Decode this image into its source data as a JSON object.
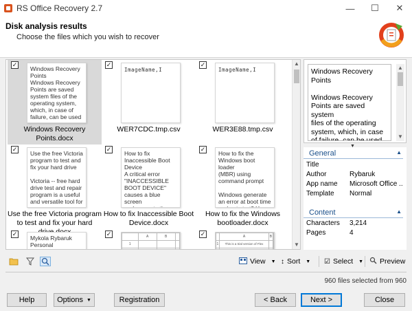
{
  "window": {
    "title": "RS Office Recovery 2.7",
    "minimize_glyph": "—",
    "maximize_glyph": "☐",
    "close_glyph": "✕"
  },
  "header": {
    "title": "Disk analysis results",
    "subtitle": "Choose the files which you wish to recover"
  },
  "files": [
    {
      "name": "Windows Recovery Points.docx",
      "checked": true,
      "selected": true,
      "thumb_type": "text",
      "thumb_text": "Windows Recovery\nPoints\nWindows Recovery\nPoints are saved\nsystem files of the\noperating system,\nwhich, in case of\nfailure, can be used"
    },
    {
      "name": "WER7CDC.tmp.csv",
      "checked": true,
      "selected": false,
      "thumb_type": "mono",
      "thumb_text": "ImageName,I"
    },
    {
      "name": "WER3E88.tmp.csv",
      "checked": true,
      "selected": false,
      "thumb_type": "mono",
      "thumb_text": "ImageName,I"
    },
    {
      "name": "Use the free Victoria program to test and fix your hard drive.docx",
      "checked": true,
      "selected": false,
      "thumb_type": "text",
      "thumb_text": "Use the free Victoria\nprogram to test and\nfix your hard drive\n\nVictoria -- free hard\ndrive test and repair\nprogram is a useful\nand versatile tool for"
    },
    {
      "name": "How to fix Inaccessible Boot Device.docx",
      "checked": true,
      "selected": false,
      "thumb_type": "text",
      "thumb_text": "How to fix\nInaccessible Boot\nDevice\nA critical error\n\"INACCESSIBLE\nBOOT DEVICE\"\ncauses a blue screen\nand prevents the"
    },
    {
      "name": "How to fix the Windows bootloader.docx",
      "checked": true,
      "selected": false,
      "thumb_type": "text",
      "thumb_text": "How to fix the\nWindows boot loader\n(MBR) using\ncommand prompt\n\nWindows generate\nan error at boot time\nand not start? You"
    },
    {
      "name": "",
      "checked": true,
      "selected": false,
      "thumb_type": "text",
      "thumb_text": "Mykola Rybaruk\nPersonal information:"
    },
    {
      "name": "",
      "checked": true,
      "selected": false,
      "thumb_type": "sheet",
      "thumb_text": ""
    },
    {
      "name": "",
      "checked": true,
      "selected": false,
      "thumb_type": "sheet",
      "thumb_text": "This is a trial version of Flex"
    }
  ],
  "sheet": {
    "col_a": "A",
    "col_b": "B",
    "row_1": "1",
    "row_2": "2"
  },
  "preview": {
    "text": "Windows Recovery\nPoints\n\nWindows Recovery\nPoints are saved system\nfiles of the operating\nsystem, which, in case\nof failure, can be used\nto restore the correct"
  },
  "properties": {
    "general_label": "General",
    "content_label": "Content",
    "general": [
      {
        "key": "Title",
        "value": ""
      },
      {
        "key": "Author",
        "value": "Rybaruk"
      },
      {
        "key": "App name",
        "value": "Microsoft Office ..."
      },
      {
        "key": "Template",
        "value": "Normal"
      }
    ],
    "content": [
      {
        "key": "Characters",
        "value": "3,214"
      },
      {
        "key": "Pages",
        "value": "4"
      }
    ]
  },
  "toolbar": {
    "view_label": "View",
    "sort_label": "Sort",
    "select_label": "Select",
    "preview_label": "Preview"
  },
  "status": {
    "text": "960 files selected from 960"
  },
  "buttons": {
    "help": "Help",
    "options": "Options",
    "registration": "Registration",
    "back": "< Back",
    "next": "Next >",
    "close": "Close"
  },
  "colors": {
    "accent": "#0078d7",
    "section_header": "#1a4f8a",
    "logo_red": "#e2401c",
    "logo_green": "#5aa832",
    "logo_orange": "#f29f1c"
  }
}
